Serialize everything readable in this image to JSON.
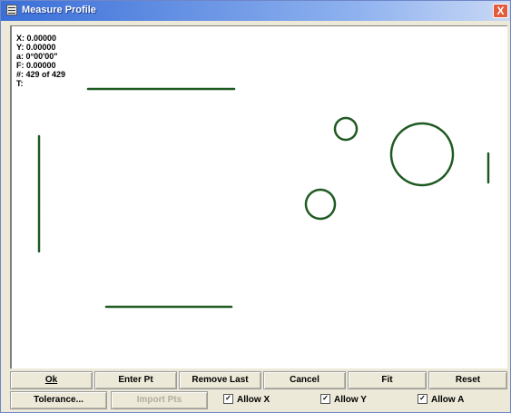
{
  "window": {
    "title": "Measure Profile",
    "close_glyph": "X"
  },
  "readout": {
    "x": "X: 0.00000",
    "y": "Y: 0.00000",
    "a": "a: 0°00'00\"",
    "f": "F: 0.00000",
    "count": "#: 429 of 429",
    "t": "T:"
  },
  "profile": {
    "stroke_color": "#1f5a22"
  },
  "buttons": {
    "ok": "Ok",
    "enter_pt": "Enter Pt",
    "remove_last": "Remove Last",
    "cancel": "Cancel",
    "fit": "Fit",
    "reset": "Reset",
    "tolerance": "Tolerance...",
    "import_pts": "Import Pts"
  },
  "checkboxes": {
    "allow_x": {
      "label": "Allow X",
      "checked": true
    },
    "allow_y": {
      "label": "Allow Y",
      "checked": true
    },
    "allow_a": {
      "label": "Allow A",
      "checked": true
    }
  },
  "icons": {
    "app": "window-icon",
    "close": "close-icon",
    "check": "checkmark-icon"
  }
}
